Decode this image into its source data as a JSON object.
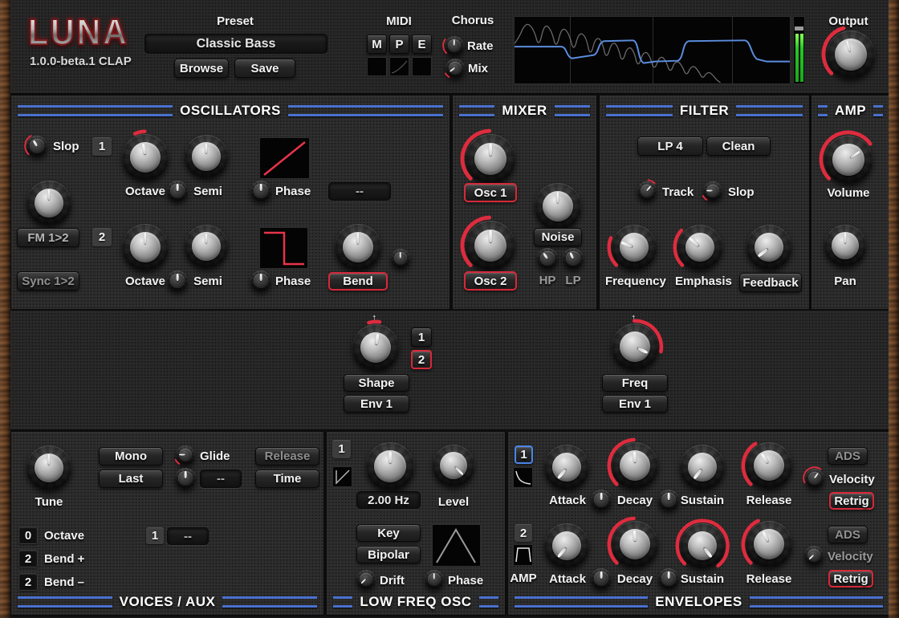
{
  "app": {
    "logo": "LUNA",
    "version": "1.0.0-beta.1 CLAP"
  },
  "header": {
    "preset": {
      "label": "Preset",
      "value": "Classic Bass",
      "browse": "Browse",
      "save": "Save"
    },
    "midi": {
      "label": "MIDI",
      "m": "M",
      "p": "P",
      "e": "E"
    },
    "chorus": {
      "label": "Chorus",
      "rate_label": "Rate",
      "mix_label": "Mix",
      "knobs": {
        "rate": {
          "angle": 0,
          "arc": [
            -135,
            -55
          ]
        },
        "mix": {
          "angle": -128,
          "arc": [
            -147,
            -120
          ]
        }
      }
    },
    "output": {
      "label": "Output",
      "knobs": {
        "main": {
          "angle": -15,
          "arc": [
            -135,
            -15
          ]
        }
      }
    },
    "icons": {
      "scope": "spectrum-analyzer-display",
      "meter": "output-level-meter"
    }
  },
  "oscillators": {
    "title": "OSCILLATORS",
    "slop_label": "Slop",
    "fm_button": "FM 1>2",
    "sync_button": "Sync 1>2",
    "osc1": {
      "num": "1",
      "octave_label": "Octave",
      "semi_label": "Semi",
      "phase_label": "Phase",
      "mod_select": "--",
      "wave_icon": "saw-up-wave"
    },
    "osc2": {
      "num": "2",
      "octave_label": "Octave",
      "semi_label": "Semi",
      "phase_label": "Phase",
      "bend_button": "Bend",
      "wave_icon": "pulse-wave"
    },
    "knobs": {
      "slop": {
        "angle": -30,
        "arc": [
          -135,
          -30
        ]
      },
      "fm_amount": {
        "angle": 0
      },
      "o1_octave": {
        "angle": -10,
        "arc": [
          -24,
          -2
        ]
      },
      "o1_fine": {
        "angle": 0
      },
      "o1_semi": {
        "angle": 0
      },
      "o1_phase": {
        "angle": 0
      },
      "o2_octave": {
        "angle": 0
      },
      "o2_fine": {
        "angle": 0
      },
      "o2_semi": {
        "angle": 0
      },
      "o2_phase": {
        "angle": 0
      },
      "bend": {
        "angle": 0
      },
      "bend_aux": {
        "angle": 0
      }
    }
  },
  "mixer": {
    "title": "MIXER",
    "osc1_button": "Osc 1",
    "osc2_button": "Osc 2",
    "noise_button": "Noise",
    "hp_label": "HP",
    "lp_label": "LP",
    "knobs": {
      "osc1": {
        "angle": 0,
        "arc": [
          -135,
          -2
        ]
      },
      "osc2": {
        "angle": 0,
        "arc": [
          -135,
          -2
        ]
      },
      "noise": {
        "angle": 0
      },
      "hp": {
        "angle": -35
      },
      "lp": {
        "angle": -25
      }
    }
  },
  "filter": {
    "title": "FILTER",
    "type_button": "LP 4",
    "mode_button": "Clean",
    "track_label": "Track",
    "slop_label": "Slop",
    "frequency_label": "Frequency",
    "emphasis_label": "Emphasis",
    "feedback_button": "Feedback",
    "knobs": {
      "track": {
        "angle": 40,
        "arc": [
          8,
          48
        ]
      },
      "slop": {
        "angle": -90,
        "arc": [
          -147,
          -118
        ]
      },
      "frequency": {
        "angle": -68,
        "arc": [
          -135,
          -68
        ]
      },
      "emphasis": {
        "angle": -48,
        "arc": [
          -135,
          -48
        ]
      },
      "feedback": {
        "angle": -128
      }
    }
  },
  "amp": {
    "title": "AMP",
    "volume_label": "Volume",
    "pan_label": "Pan",
    "knobs": {
      "volume": {
        "angle": 55,
        "arc": [
          -135,
          55
        ]
      },
      "pan": {
        "angle": 0
      }
    }
  },
  "mod": {
    "arrow_glyph": "↑",
    "shape": {
      "label": "Shape",
      "source": "Env 1",
      "tab1": "1",
      "tab2": "2"
    },
    "freq": {
      "label": "Freq",
      "source": "Env 1"
    },
    "knobs": {
      "shape": {
        "angle": 8,
        "arc": [
          -16,
          8
        ]
      },
      "freq": {
        "angle": 115,
        "arc": [
          -2,
          100
        ]
      }
    }
  },
  "voices": {
    "title": "VOICES / AUX",
    "tune_label": "Tune",
    "mono_button": "Mono",
    "last_button": "Last",
    "glide_label": "Glide",
    "glide_select": "--",
    "release_button": "Release",
    "time_button": "Time",
    "rows": [
      {
        "value": "0",
        "label": "Octave"
      },
      {
        "value": "2",
        "label": "Bend +"
      },
      {
        "value": "2",
        "label": "Bend –"
      }
    ],
    "aux_num": "1",
    "aux_select": "--",
    "knobs": {
      "tune": {
        "angle": 0
      },
      "glide": {
        "angle": -90,
        "arc": [
          -147,
          -118
        ]
      },
      "glide_fine": {
        "angle": 0
      }
    }
  },
  "lfo": {
    "title": "LOW FREQ OSC",
    "num": "1",
    "rate_value": "2.00 Hz",
    "level_label": "Level",
    "key_button": "Key",
    "bipolar_button": "Bipolar",
    "drift_label": "Drift",
    "phase_label": "Phase",
    "wave_icon": "triangle-wave",
    "shape_icon": "saw-down-wave",
    "knobs": {
      "rate": {
        "angle": 0
      },
      "level": {
        "angle": 135
      },
      "drift": {
        "angle": -135
      },
      "phase": {
        "angle": 0
      }
    }
  },
  "envelopes": {
    "title": "ENVELOPES",
    "env1": {
      "num": "1",
      "icon": "decay-curve",
      "attack_label": "Attack",
      "decay_label": "Decay",
      "sustain_label": "Sustain",
      "release_label": "Release",
      "ads_button": "ADS",
      "velocity_label": "Velocity",
      "retrig_button": "Retrig",
      "knobs": {
        "attack": {
          "angle": -140
        },
        "ad_mod": {
          "angle": 0
        },
        "decay": {
          "angle": -3,
          "arc": [
            -135,
            -3
          ]
        },
        "ds_mod": {
          "angle": 0
        },
        "sustain": {
          "angle": -142
        },
        "release": {
          "angle": -32,
          "arc": [
            -135,
            -32
          ]
        },
        "velocity": {
          "angle": 35,
          "arc": [
            -115,
            35
          ]
        }
      }
    },
    "env2": {
      "num": "2",
      "icon": "trapezoid-envelope",
      "amp_label": "AMP",
      "attack_label": "Attack",
      "decay_label": "Decay",
      "sustain_label": "Sustain",
      "release_label": "Release",
      "ads_button": "ADS",
      "velocity_label": "Velocity",
      "retrig_button": "Retrig",
      "knobs": {
        "attack": {
          "angle": -140
        },
        "ad_mod": {
          "angle": 0
        },
        "decay": {
          "angle": -3,
          "arc": [
            -135,
            -3
          ]
        },
        "ds_mod": {
          "angle": 0
        },
        "sustain": {
          "angle": 142,
          "arc": [
            -135,
            142
          ]
        },
        "release": {
          "angle": -25,
          "arc": [
            -135,
            -25
          ]
        },
        "velocity": {
          "angle": -135
        }
      }
    }
  },
  "colors": {
    "accent_red": "#dd2c3e",
    "accent_blue": "#4a71cf",
    "meter_green": "#2bc42b",
    "spectrum_line": "#5b8dde",
    "wave_red": "#e8334a"
  }
}
